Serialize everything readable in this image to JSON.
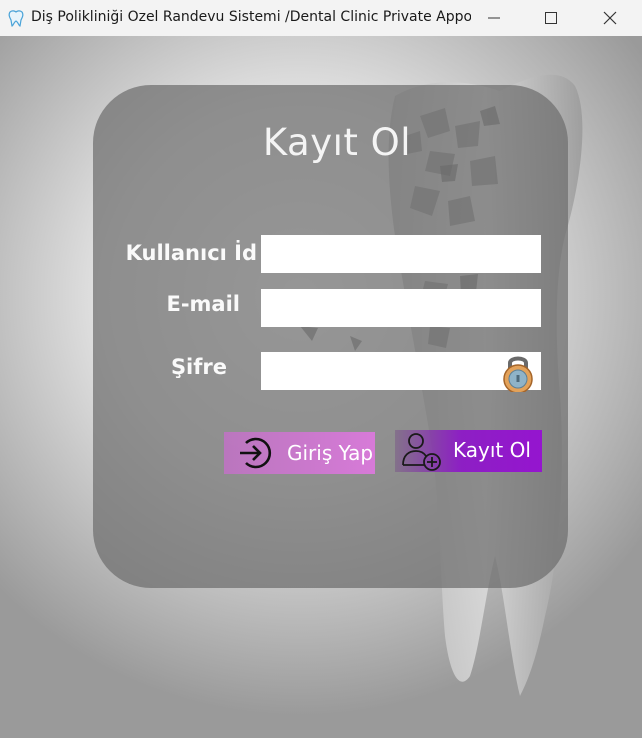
{
  "window": {
    "title": "Diş Polikliniği Özel Randevu Sistemi /Dental Clinic Private Appo..."
  },
  "form": {
    "heading": "Kayıt Ol",
    "username_label": "Kullanıcı İd",
    "email_label": "E-mail",
    "password_label": "Şifre",
    "username_value": "",
    "email_value": "",
    "password_value": ""
  },
  "buttons": {
    "login_label": "Giriş Yap",
    "register_label": "Kayıt Ol"
  },
  "icons": {
    "app": "tooth-icon",
    "minimize": "minimize-icon",
    "maximize": "maximize-icon",
    "close": "close-icon",
    "lock": "padlock-icon",
    "login": "sign-in-arrow-icon",
    "register": "add-user-icon"
  },
  "colors": {
    "login_button": "#d77ad8",
    "register_button": "#9515cf",
    "card": "#6e6e6e"
  }
}
